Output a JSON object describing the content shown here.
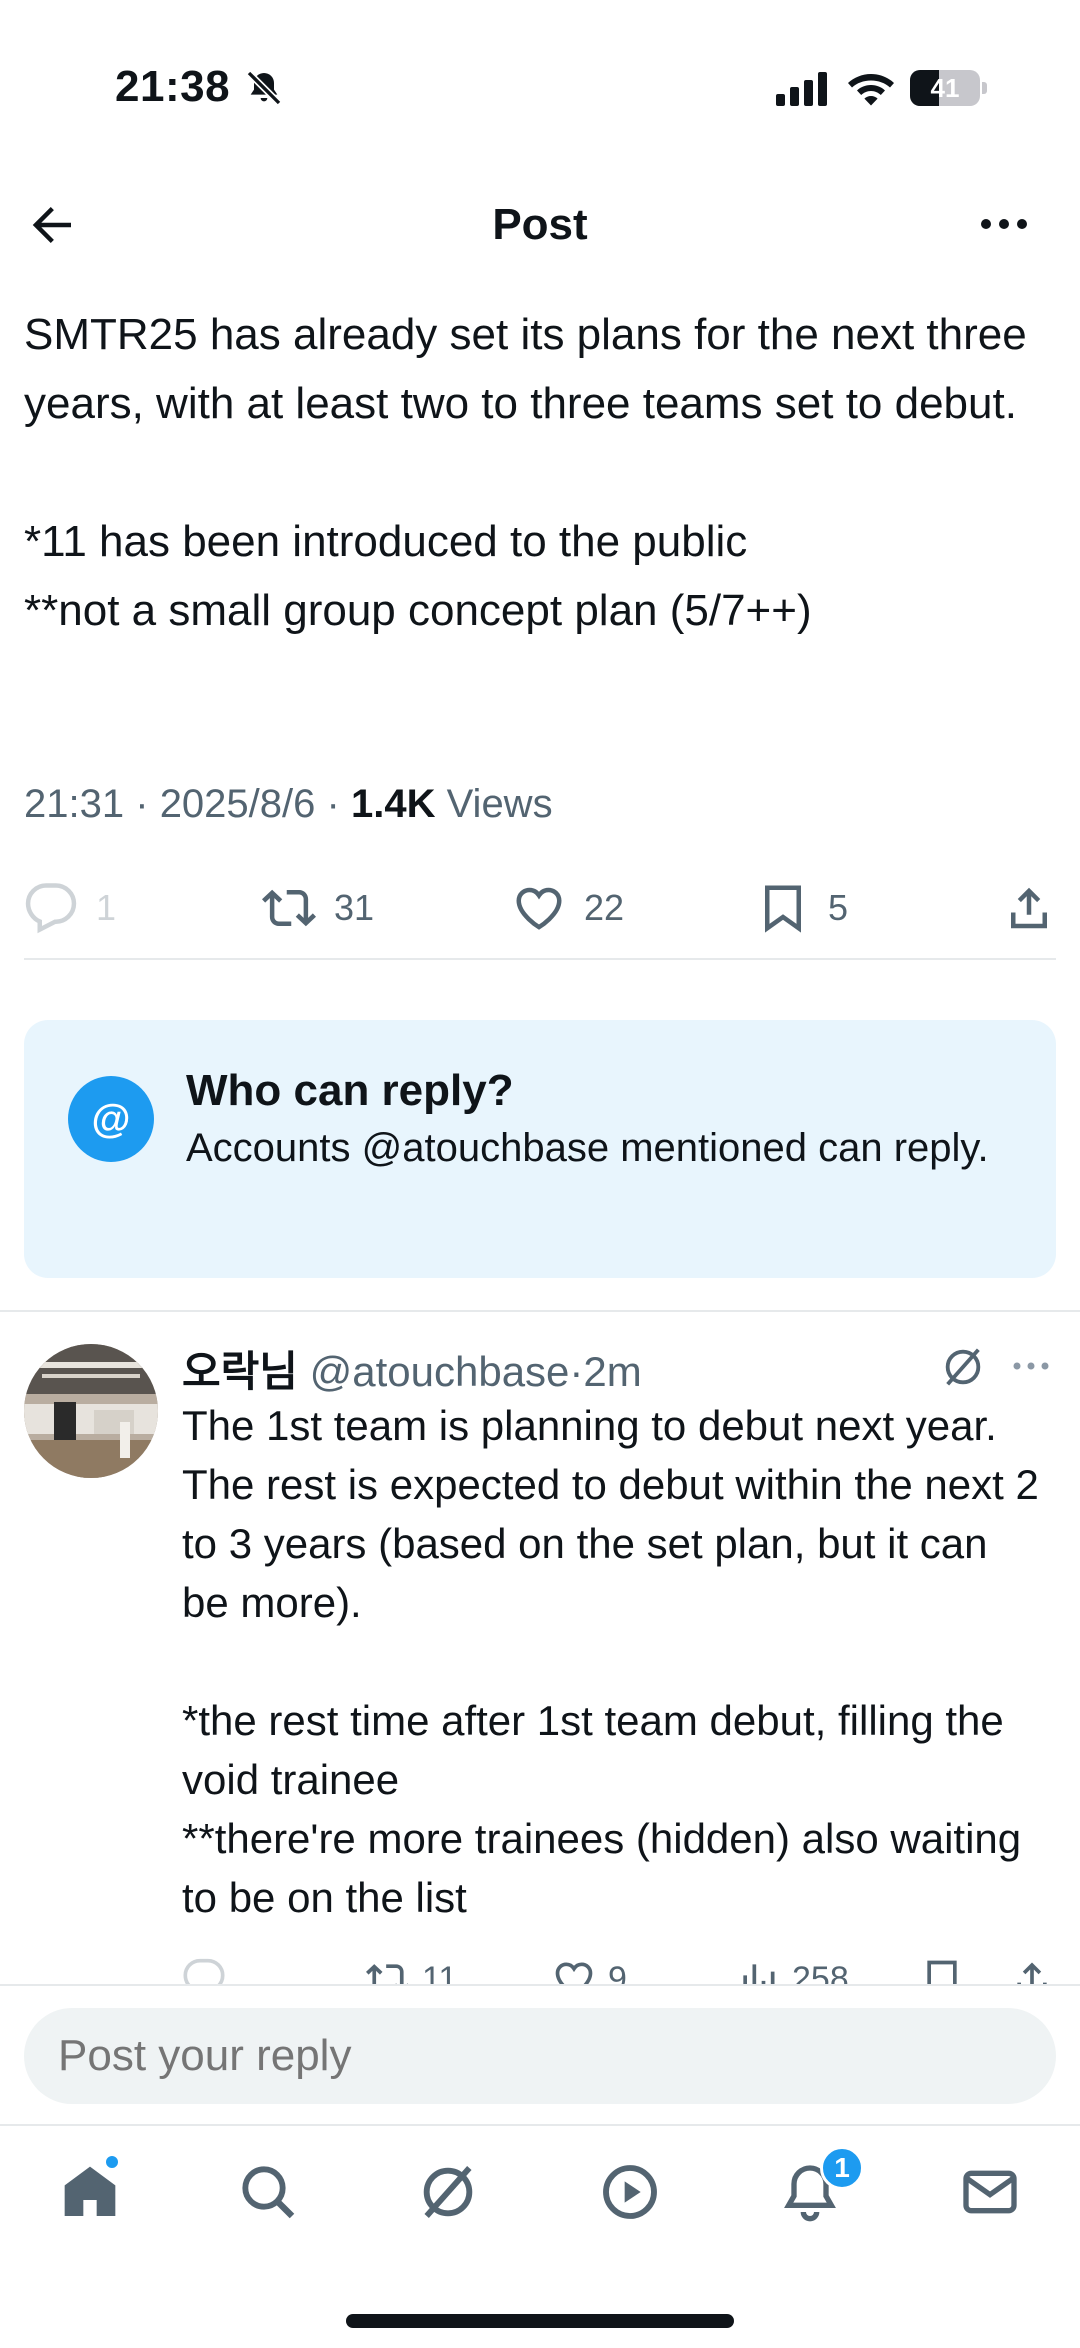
{
  "status_bar": {
    "time": "21:38",
    "battery_level": "41",
    "battery_fraction": 0.41
  },
  "header": {
    "title": "Post"
  },
  "post": {
    "text": "SMTR25 has already set its plans for the next three years, with at least two to three teams set to debut.\n\n*11 has been introduced to the public\n**not a small group concept plan (5/7++)",
    "time": "21:31",
    "date": "2025/8/6",
    "views_count": "1.4K",
    "views_label": "Views",
    "replies": "1",
    "reposts": "31",
    "likes": "22",
    "bookmarks": "5"
  },
  "reply_restriction": {
    "icon_glyph": "@",
    "title": "Who can reply?",
    "body": "Accounts @atouchbase mentioned can reply."
  },
  "reply": {
    "name": "오락님",
    "handle": "@atouchbase",
    "age": "2m",
    "text": "The 1st team is planning to debut next year. The rest is expected to debut within the next 2 to 3 years (based on the set plan, but it can be more).\n\n*the rest time after 1st team debut, filling the void trainee\n**there're more trainees (hidden) also waiting to be on the list",
    "reposts": "11",
    "likes": "9",
    "views": "258"
  },
  "composer": {
    "placeholder": "Post your reply"
  },
  "tabbar": {
    "notifications_badge": "1"
  },
  "icons": {
    "status": [
      "bell-off-icon",
      "signal-icon",
      "wifi-icon",
      "battery-icon"
    ],
    "header": [
      "back-arrow-icon",
      "more-icon"
    ],
    "actions": [
      "reply-icon",
      "repost-icon",
      "like-icon",
      "bookmark-icon",
      "share-icon",
      "views-icon"
    ],
    "tabs": [
      "home-icon",
      "search-icon",
      "grok-icon",
      "video-icon",
      "notifications-icon",
      "messages-icon"
    ]
  },
  "colors": {
    "accent": "#1d9bf0",
    "text": "#0f1419",
    "secondary_text": "#536471",
    "card_background": "#e8f5fd"
  }
}
